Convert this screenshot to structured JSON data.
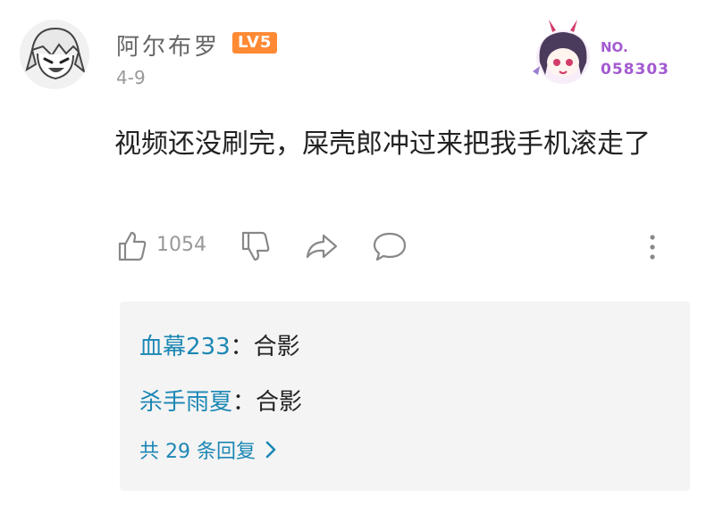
{
  "header": {
    "username": "阿尔布罗",
    "level": "LV5",
    "date": "4-9",
    "fan_badge": {
      "label": "NO.",
      "number": "058303"
    }
  },
  "comment": {
    "text": "视频还没刷完，屎壳郎冲过来把我手机滚走了"
  },
  "actions": {
    "like_count": "1054"
  },
  "replies": {
    "items": [
      {
        "name": "血幕233",
        "sep": "：",
        "text": "合影"
      },
      {
        "name": "杀手雨夏",
        "sep": "：",
        "text": "合影"
      }
    ],
    "count_text": "共 29 条回复"
  },
  "colors": {
    "level_badge": "#ff8a34",
    "reply_name": "#1c87b5",
    "fan_badge_text": "#a35bd1",
    "reply_bg": "#f4f4f4"
  }
}
